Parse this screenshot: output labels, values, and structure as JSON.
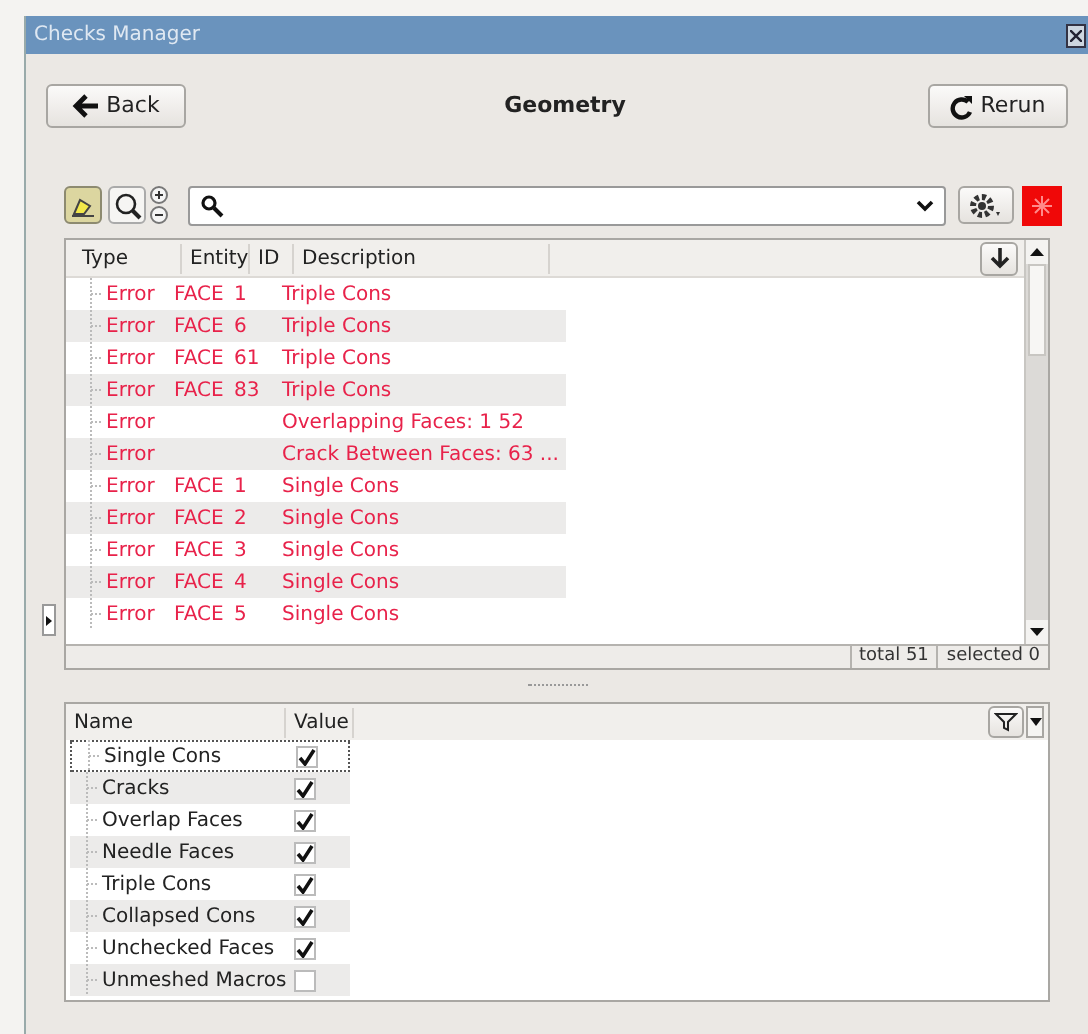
{
  "window": {
    "title": "Checks Manager"
  },
  "header": {
    "back": "Back",
    "title": "Geometry",
    "rerun": "Rerun"
  },
  "toolbar": {
    "highlight_selected": true
  },
  "results": {
    "columns": [
      "Type",
      "Entity",
      "ID",
      "Description"
    ],
    "rows": [
      {
        "type": "Error",
        "entity": "FACE",
        "id": "1",
        "description": "Triple Cons"
      },
      {
        "type": "Error",
        "entity": "FACE",
        "id": "6",
        "description": "Triple Cons"
      },
      {
        "type": "Error",
        "entity": "FACE",
        "id": "61",
        "description": "Triple Cons"
      },
      {
        "type": "Error",
        "entity": "FACE",
        "id": "83",
        "description": "Triple Cons"
      },
      {
        "type": "Error",
        "entity": "",
        "id": "",
        "description": "Overlapping Faces: 1 52"
      },
      {
        "type": "Error",
        "entity": "",
        "id": "",
        "description": "Crack Between Faces: 63 ..."
      },
      {
        "type": "Error",
        "entity": "FACE",
        "id": "1",
        "description": "Single Cons"
      },
      {
        "type": "Error",
        "entity": "FACE",
        "id": "2",
        "description": "Single Cons"
      },
      {
        "type": "Error",
        "entity": "FACE",
        "id": "3",
        "description": "Single Cons"
      },
      {
        "type": "Error",
        "entity": "FACE",
        "id": "4",
        "description": "Single Cons"
      },
      {
        "type": "Error",
        "entity": "FACE",
        "id": "5",
        "description": "Single Cons"
      }
    ],
    "total": "total 51",
    "selected": "selected 0"
  },
  "checks": {
    "columns": [
      "Name",
      "Value"
    ],
    "items": [
      {
        "name": "Single Cons",
        "checked": true,
        "selected": true
      },
      {
        "name": "Cracks",
        "checked": true,
        "selected": false
      },
      {
        "name": "Overlap Faces",
        "checked": true,
        "selected": false
      },
      {
        "name": "Needle Faces",
        "checked": true,
        "selected": false
      },
      {
        "name": "Triple Cons",
        "checked": true,
        "selected": false
      },
      {
        "name": "Collapsed Cons",
        "checked": true,
        "selected": false
      },
      {
        "name": "Unchecked Faces",
        "checked": true,
        "selected": false
      },
      {
        "name": "Unmeshed Macros",
        "checked": false,
        "selected": false
      }
    ]
  }
}
